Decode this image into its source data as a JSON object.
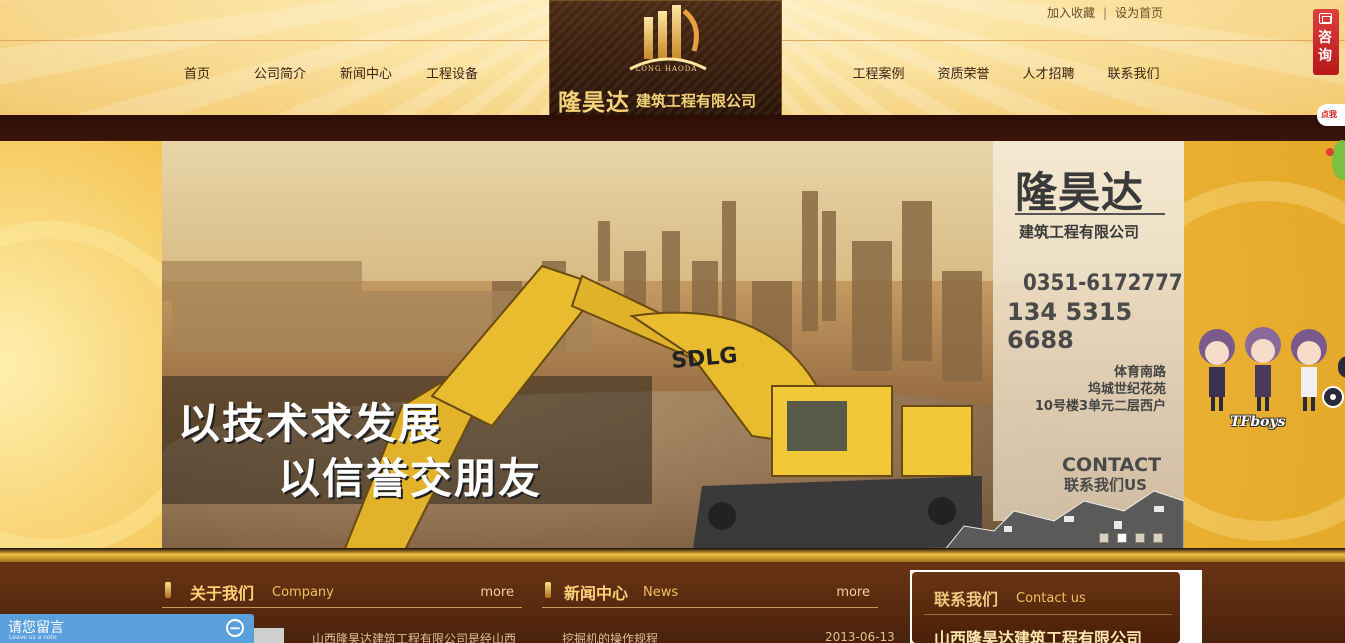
{
  "header": {
    "toplinks": {
      "favorite": "加入收藏",
      "separator": "|",
      "homepage": "设为首页"
    },
    "nav_left": [
      "首页",
      "公司简介",
      "新闻中心",
      "工程设备"
    ],
    "nav_right": [
      "工程案例",
      "资质荣誉",
      "人才招聘",
      "联系我们"
    ],
    "logo": {
      "sub": "LONG HAODA",
      "name": "隆昊达",
      "company": "建筑工程有限公司"
    }
  },
  "banner": {
    "slogan1": "以技术求发展",
    "slogan2": "以信誉交朋友",
    "brand_on_machine": "SDLG",
    "panel": {
      "title": "隆昊达",
      "company": "建筑工程有限公司",
      "phone1": "0351-6172777",
      "phone2": "134 5315 6688",
      "addr1": "体育南路",
      "addr2": "坞城世纪花苑",
      "addr3": "10号楼3单元二层西户",
      "contact": "CONTACT",
      "contact_cn": "联系我们US"
    },
    "slides_count": 4,
    "active_slide": 2
  },
  "sections": {
    "about": {
      "title": "关于我们",
      "en": "Company",
      "more": "more"
    },
    "news": {
      "title": "新闻中心",
      "en": "News",
      "more": "more"
    },
    "contact": {
      "title": "联系我们",
      "en": "Contact us",
      "company": "山西隆昊达建筑工程有限公司"
    }
  },
  "lower_text": {
    "about_snippet": "山西隆昊达建筑工程有限公司是经山西",
    "news_item": "挖掘机的操作规程",
    "news_date": "2013-06-13"
  },
  "widgets": {
    "message_bar": {
      "label": "请您留言",
      "sub": "Leave us a note",
      "minimize": "−"
    },
    "consult": {
      "label": "咨询"
    },
    "click_me": "点我",
    "tfboys": "TFboys"
  },
  "colors": {
    "header_bg": "#fbe2a0",
    "dark_band": "#2c0e06",
    "banner_gold": "#f3c14c",
    "lower_brown": "#6a3414",
    "message_blue": "#5aa0dc",
    "consult_red": "#d02828"
  }
}
